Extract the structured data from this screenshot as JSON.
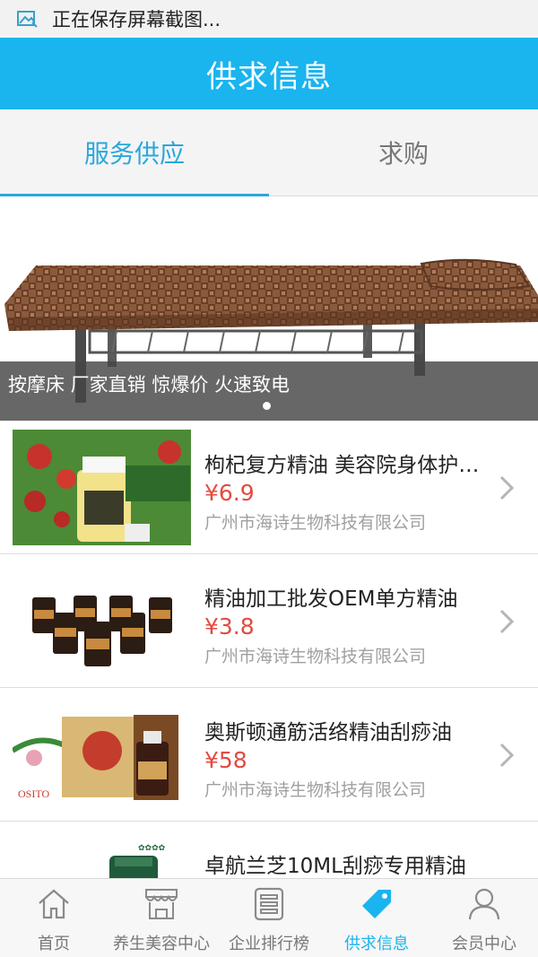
{
  "status_bar": {
    "text": "正在保存屏幕截图...",
    "icon": "screenshot-icon"
  },
  "header": {
    "title": "供求信息"
  },
  "tabs": [
    {
      "label": "服务供应",
      "active": true
    },
    {
      "label": "求购",
      "active": false
    }
  ],
  "banner": {
    "caption": "按摩床 厂家直销 惊爆价 火速致电",
    "image": "massage-bed-photo",
    "slide_index": 1,
    "slide_count": 1
  },
  "products": [
    {
      "name": "枸杞复方精油 美容院身体护理香薰精油",
      "price": "¥6.9",
      "company": "广州市海诗生物科技有限公司",
      "image": "goji-oil-bottle-photo"
    },
    {
      "name": "精油加工批发OEM单方精油",
      "price": "¥3.8",
      "company": "广州市海诗生物科技有限公司",
      "image": "oil-bottles-photo"
    },
    {
      "name": "奥斯顿通筋活络精油刮痧油",
      "price": "¥58",
      "company": "广州市海诗生物科技有限公司",
      "image": "osito-oil-box-photo"
    },
    {
      "name": "卓航兰芝10ML刮痧专用精油",
      "price": "",
      "company": "",
      "image": "green-bottle-photo"
    }
  ],
  "tabbar": [
    {
      "label": "首页",
      "icon": "home-icon",
      "active": false
    },
    {
      "label": "养生美容中心",
      "icon": "store-icon",
      "active": false
    },
    {
      "label": "企业排行榜",
      "icon": "list-icon",
      "active": false
    },
    {
      "label": "供求信息",
      "icon": "tag-icon",
      "active": true
    },
    {
      "label": "会员中心",
      "icon": "user-icon",
      "active": false
    }
  ],
  "colors": {
    "brand": "#1ab4ef",
    "tab_active": "#2aa7dd",
    "price": "#e24b42"
  }
}
